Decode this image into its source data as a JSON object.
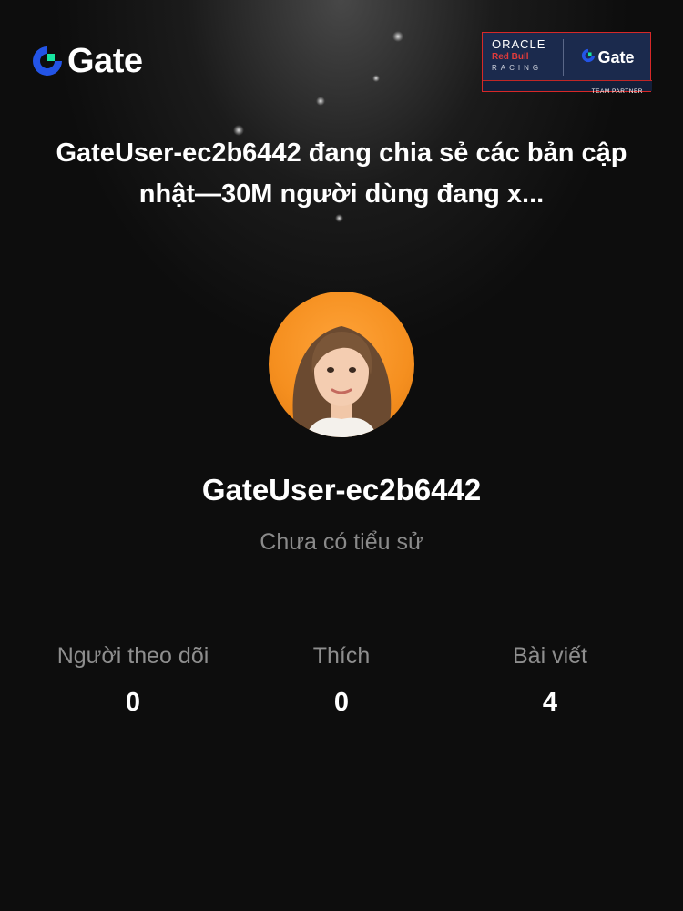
{
  "brand": {
    "name": "Gate",
    "logo_icon": "gate-logo-icon",
    "accent_blue": "#2354e6",
    "accent_green": "#17e6a1"
  },
  "partner_badge": {
    "oracle": "ORACLE",
    "redbull": "Red Bull",
    "racing": "RACING",
    "gate": "Gate",
    "team_partner": "TEAM PARTNER"
  },
  "headline": "GateUser-ec2b6442 đang chia sẻ các bản cập nhật—30M người dùng đang x...",
  "profile": {
    "avatar_icon": "avatar-image",
    "username": "GateUser-ec2b6442",
    "bio": "Chưa có tiểu sử"
  },
  "stats": [
    {
      "label": "Người theo dõi",
      "value": "0"
    },
    {
      "label": "Thích",
      "value": "0"
    },
    {
      "label": "Bài viết",
      "value": "4"
    }
  ]
}
